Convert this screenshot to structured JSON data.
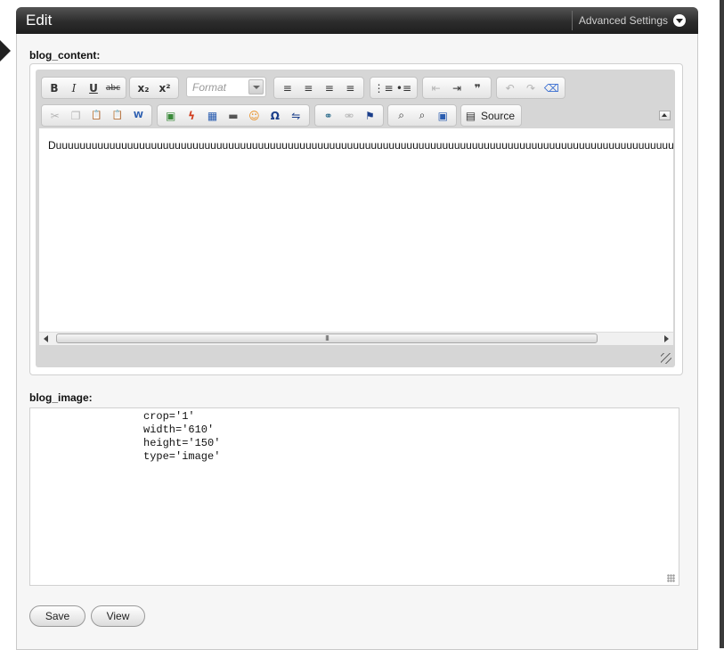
{
  "panel": {
    "title": "Edit",
    "advanced_settings_label": "Advanced Settings"
  },
  "fields": {
    "blog_content_label": "blog_content:",
    "blog_image_label": "blog_image:"
  },
  "editor": {
    "format_placeholder": "Format",
    "source_label": "Source",
    "content_text": "Duuuuuuuuuuuuuuuuuuuuuuuuuuuuuuuuuuuuuuuuuuuuuuuuuuuuuuuuuuuuuuuuuuuuuuuuuuuuuuuuuuuuuuuuuuuuuuuuuuuuuuuu",
    "scroll_thumb_grip": "III",
    "toolbar_row1": [
      {
        "name": "bold-button",
        "glyph": "B",
        "icon": "bold-icon"
      },
      {
        "name": "italic-button",
        "glyph": "I",
        "icon": "italic-icon"
      },
      {
        "name": "underline-button",
        "glyph": "U",
        "icon": "underline-icon"
      },
      {
        "name": "strikethrough-button",
        "glyph": "abc",
        "icon": "strikethrough-icon"
      },
      {
        "name": "subscript-button",
        "glyph": "x₂",
        "icon": "subscript-icon"
      },
      {
        "name": "superscript-button",
        "glyph": "x²",
        "icon": "superscript-icon"
      },
      {
        "name": "align-left-button",
        "glyph": "≡",
        "icon": "align-left-icon"
      },
      {
        "name": "align-center-button",
        "glyph": "≡",
        "icon": "align-center-icon"
      },
      {
        "name": "align-right-button",
        "glyph": "≡",
        "icon": "align-right-icon"
      },
      {
        "name": "justify-button",
        "glyph": "≡",
        "icon": "justify-icon"
      },
      {
        "name": "numbered-list-button",
        "glyph": "⋮≡",
        "icon": "numbered-list-icon"
      },
      {
        "name": "bullet-list-button",
        "glyph": "•≡",
        "icon": "bullet-list-icon"
      },
      {
        "name": "outdent-button",
        "glyph": "⇤",
        "icon": "outdent-icon"
      },
      {
        "name": "indent-button",
        "glyph": "⇥",
        "icon": "indent-icon"
      },
      {
        "name": "blockquote-button",
        "glyph": "❞",
        "icon": "blockquote-icon"
      },
      {
        "name": "undo-button",
        "glyph": "↶",
        "icon": "undo-icon"
      },
      {
        "name": "redo-button",
        "glyph": "↷",
        "icon": "redo-icon"
      },
      {
        "name": "remove-format-button",
        "glyph": "⌫",
        "icon": "eraser-icon"
      }
    ],
    "toolbar_row2": [
      {
        "name": "cut-button",
        "glyph": "✂",
        "icon": "cut-icon"
      },
      {
        "name": "copy-button",
        "glyph": "❐",
        "icon": "copy-icon"
      },
      {
        "name": "paste-button",
        "glyph": "📋",
        "icon": "paste-icon"
      },
      {
        "name": "paste-text-button",
        "glyph": "📋",
        "icon": "paste-text-icon"
      },
      {
        "name": "paste-word-button",
        "glyph": "W",
        "icon": "paste-word-icon"
      },
      {
        "name": "image-button",
        "glyph": "▣",
        "icon": "image-icon"
      },
      {
        "name": "flash-button",
        "glyph": "ϟ",
        "icon": "flash-icon"
      },
      {
        "name": "table-button",
        "glyph": "▦",
        "icon": "table-icon"
      },
      {
        "name": "horizontal-rule-button",
        "glyph": "▬",
        "icon": "horizontal-rule-icon"
      },
      {
        "name": "smiley-button",
        "glyph": "☺",
        "icon": "smiley-icon"
      },
      {
        "name": "special-char-button",
        "glyph": "Ω",
        "icon": "omega-icon"
      },
      {
        "name": "page-break-button",
        "glyph": "⇋",
        "icon": "page-break-icon"
      },
      {
        "name": "link-button",
        "glyph": "⚭",
        "icon": "link-icon"
      },
      {
        "name": "unlink-button",
        "glyph": "⚮",
        "icon": "unlink-icon"
      },
      {
        "name": "anchor-button",
        "glyph": "⚑",
        "icon": "anchor-flag-icon"
      },
      {
        "name": "find-button",
        "glyph": "⌕",
        "icon": "find-icon"
      },
      {
        "name": "replace-button",
        "glyph": "⌕",
        "icon": "replace-icon"
      },
      {
        "name": "select-all-button",
        "glyph": "▣",
        "icon": "select-all-icon"
      }
    ]
  },
  "blog_image": {
    "value": "crop='1'\nwidth='610'\nheight='150'\ntype='image'"
  },
  "buttons": {
    "save_label": "Save",
    "view_label": "View"
  },
  "colors": {
    "header_dark": "#2c2c2c",
    "link_blue": "#2a5db0"
  }
}
